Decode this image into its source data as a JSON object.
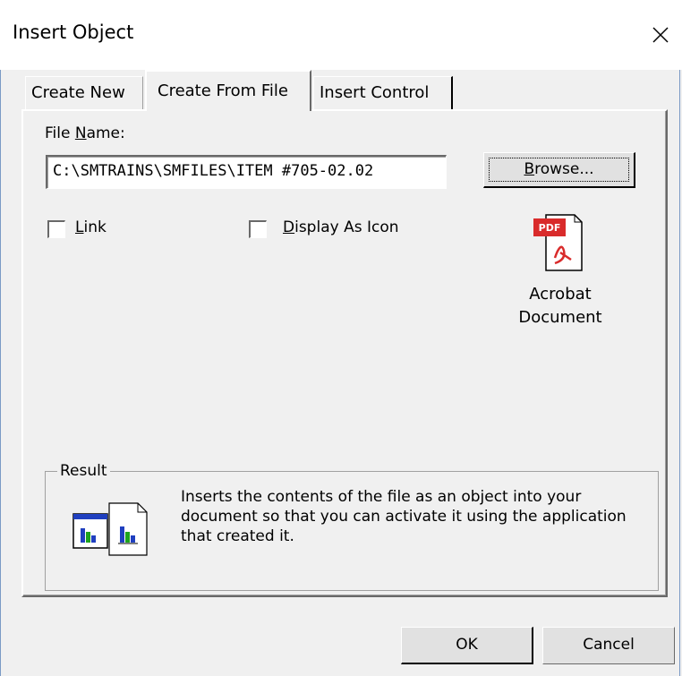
{
  "window": {
    "title": "Insert Object"
  },
  "tabs": [
    {
      "label": "Create New"
    },
    {
      "label": "Create From File"
    },
    {
      "label": "Insert Control"
    }
  ],
  "file": {
    "label_prefix": "File ",
    "label_underlined": "N",
    "label_suffix": "ame:",
    "value": "C:\\SMTRAINS\\SMFILES\\ITEM #705-02.02"
  },
  "browse": {
    "label_underlined": "B",
    "label_rest": "rowse..."
  },
  "checkboxes": {
    "link": {
      "underlined": "L",
      "rest": "ink",
      "checked": false
    },
    "display_as_icon": {
      "underlined": "D",
      "rest": "isplay As Icon",
      "checked": false
    }
  },
  "icon": {
    "line1": "Acrobat",
    "line2": "Document",
    "badge": "PDF"
  },
  "result": {
    "label": "Result",
    "text": "Inserts the contents of the file as an object into your document so that you can activate it using the application that created it."
  },
  "buttons": {
    "ok": "OK",
    "cancel": "Cancel"
  },
  "colors": {
    "pdf_red": "#d92b2b",
    "chart_blue": "#1f3fbf",
    "chart_green": "#1ea31e"
  }
}
